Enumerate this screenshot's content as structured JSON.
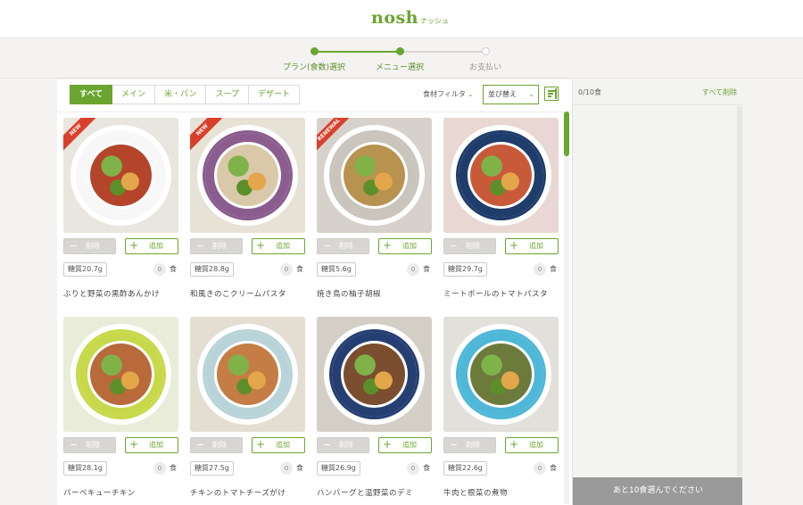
{
  "header": {
    "logo": "nosh",
    "logo_sub": "ナッシュ"
  },
  "steps": [
    {
      "label": "プラン(食数)選択",
      "state": "done"
    },
    {
      "label": "メニュー選択",
      "state": "current"
    },
    {
      "label": "お支払い",
      "state": "todo"
    }
  ],
  "tabs": [
    {
      "label": "すべて",
      "active": true
    },
    {
      "label": "メイン",
      "active": false
    },
    {
      "label": "米・パン",
      "active": false
    },
    {
      "label": "スープ",
      "active": false
    },
    {
      "label": "デザート",
      "active": false
    }
  ],
  "filter": {
    "label": "食材フィルタ",
    "chevron": "⌄"
  },
  "sort": {
    "label": "並び替え",
    "chevron": "⌄"
  },
  "card_common": {
    "delete_label": "削除",
    "add_label": "追加",
    "minus": "−",
    "plus": "+",
    "unit": "食"
  },
  "menu": [
    {
      "name": "ぶりと野菜の黒酢あんかけ",
      "carb": "糖質20.7g",
      "count": "0",
      "badge": "NEW",
      "cloth": "#e9e6df",
      "rim": "#f7f7f7",
      "food": "#b4452a"
    },
    {
      "name": "和風きのこクリームパスタ",
      "carb": "糖質28.8g",
      "count": "0",
      "badge": "NEW",
      "cloth": "#e7e2d6",
      "rim": "#8b5d8f",
      "food": "#d9c9a8"
    },
    {
      "name": "焼き鳥の柚子胡椒",
      "carb": "糖質5.6g",
      "count": "0",
      "badge": "RENEWAL",
      "cloth": "#d6d2cb",
      "rim": "#c9c4bc",
      "food": "#b8924f"
    },
    {
      "name": "ミートボールのトマトパスタ",
      "carb": "糖質29.7g",
      "count": "0",
      "badge": "",
      "cloth": "#e8d7d2",
      "rim": "#1f3d6b",
      "food": "#c85a3a"
    },
    {
      "name": "バーベキューチキン",
      "carb": "糖質28.1g",
      "count": "0",
      "badge": "",
      "cloth": "#e9ecd9",
      "rim": "#c7d94a",
      "food": "#b86a3a"
    },
    {
      "name": "チキンのトマトチーズがけ",
      "carb": "糖質27.5g",
      "count": "0",
      "badge": "",
      "cloth": "#e4ddd2",
      "rim": "#b9d4d8",
      "food": "#c67d45"
    },
    {
      "name": "ハンバーグと温野菜のデミ",
      "carb": "糖質26.9g",
      "count": "0",
      "badge": "",
      "cloth": "#d4cfc6",
      "rim": "#263f73",
      "food": "#7a4e2e"
    },
    {
      "name": "牛肉と根菜の煮物",
      "carb": "糖質22.6g",
      "count": "0",
      "badge": "",
      "cloth": "#e2e0da",
      "rim": "#4fb7d8",
      "food": "#6c7a3c"
    }
  ],
  "cart": {
    "count": "0/10食",
    "clear_label": "すべて削除",
    "button_label": "あと10食選んでください"
  }
}
